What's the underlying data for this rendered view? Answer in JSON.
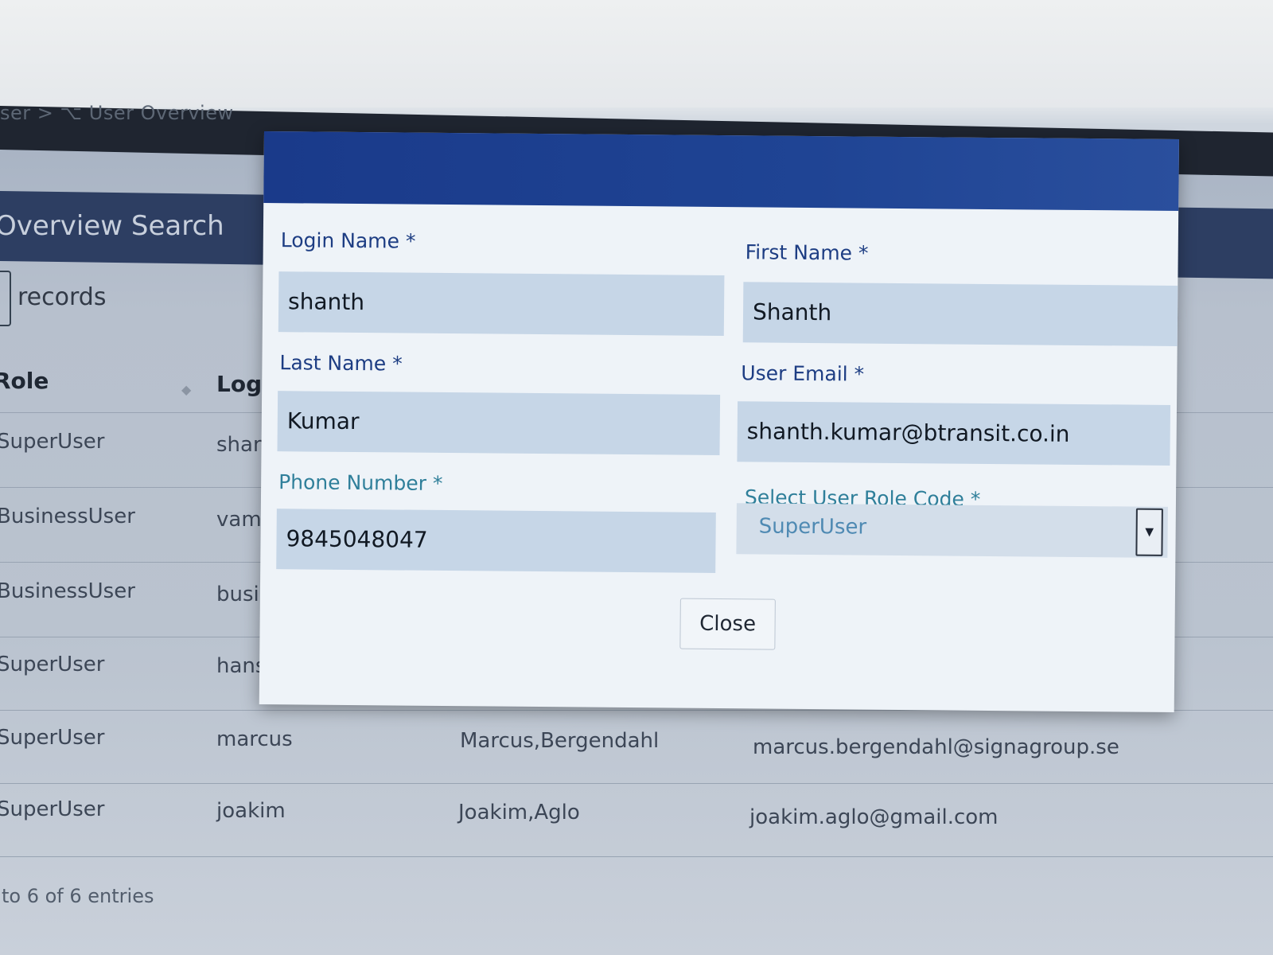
{
  "breadcrumb": {
    "text": "ser > ⌥ User Overview"
  },
  "panel": {
    "title": "Overview Search"
  },
  "table_controls": {
    "records_label": "records"
  },
  "table": {
    "columns": [
      "Role",
      "Login"
    ],
    "rows": [
      {
        "role": "SuperUser",
        "login": "shan",
        "name": "",
        "email": ""
      },
      {
        "role": "BusinessUser",
        "login": "vams",
        "name": "",
        "email": ""
      },
      {
        "role": "BusinessUser",
        "login": "busi",
        "name": "",
        "email": ""
      },
      {
        "role": "SuperUser",
        "login": "hans",
        "name": "",
        "email": ""
      },
      {
        "role": "SuperUser",
        "login": "marcus",
        "name": "Marcus,Bergendahl",
        "email": "marcus.bergendahl@signagroup.se"
      },
      {
        "role": "SuperUser",
        "login": "joakim",
        "name": "Joakim,Aglo",
        "email": "joakim.aglo@gmail.com"
      }
    ],
    "footer": "to 6 of 6 entries"
  },
  "modal": {
    "fields": {
      "login_name": {
        "label": "Login Name *",
        "value": "shanth"
      },
      "first_name": {
        "label": "First Name *",
        "value": "Shanth"
      },
      "last_name": {
        "label": "Last Name *",
        "value": "Kumar"
      },
      "user_email": {
        "label": "User Email *",
        "value": "shanth.kumar@btransit.co.in"
      },
      "phone_number": {
        "label": "Phone Number *",
        "value": "9845048047"
      },
      "role_code": {
        "label": "Select User Role Code *",
        "value": "SuperUser"
      }
    },
    "close_label": "Close"
  },
  "colors": {
    "modal_header": "#1f4494",
    "label_blue": "#1d3d83",
    "label_teal": "#2f7f9a",
    "input_bg": "#c6d6e7"
  },
  "icons": {
    "select_arrow": "chevron-down-icon",
    "sort": "sort-icon"
  }
}
